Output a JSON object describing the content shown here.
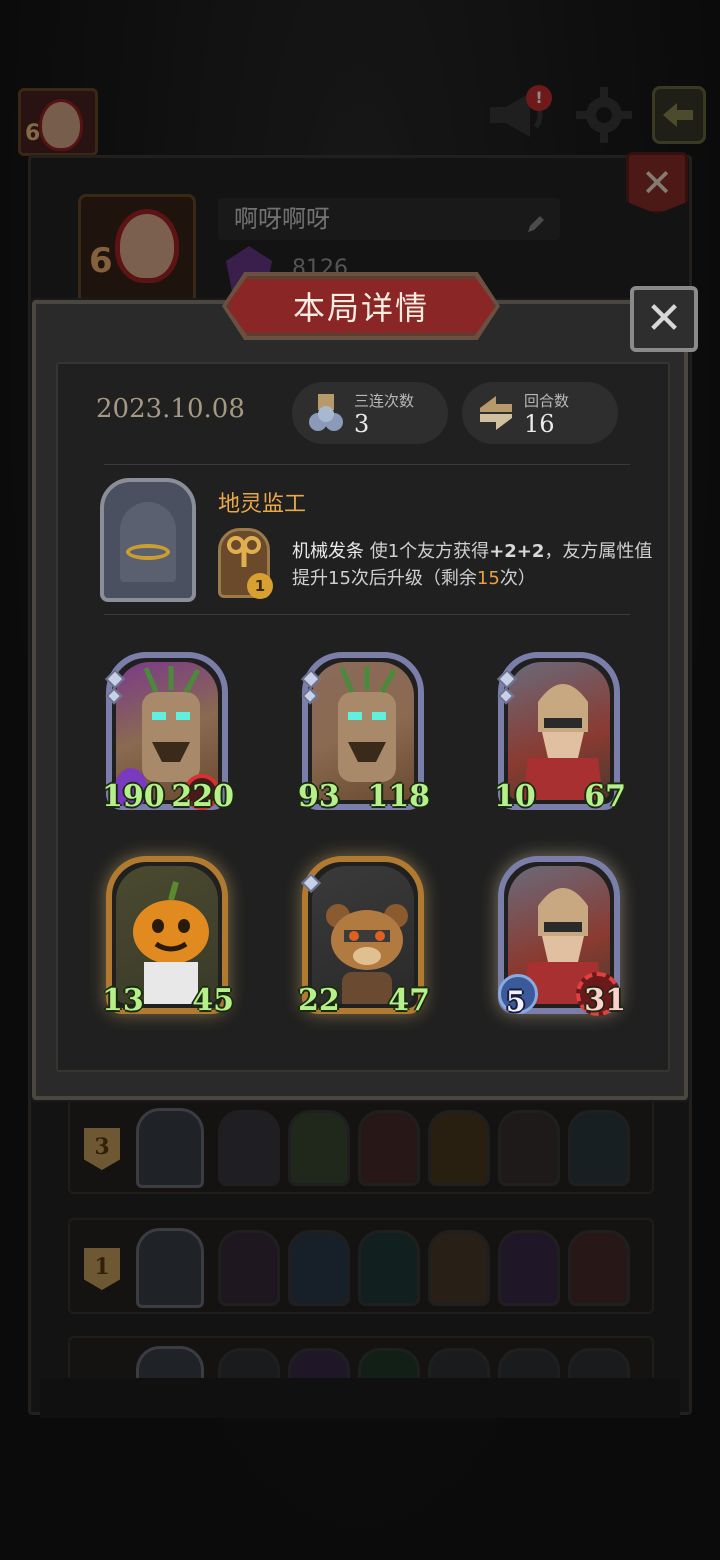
{
  "background": {
    "player_name": "啊呀啊呀",
    "score": "8126",
    "avatar_level": "6",
    "notification_badge": "!",
    "icons": [
      "megaphone-icon",
      "gear-icon",
      "exit-icon",
      "close-icon",
      "edit-icon"
    ]
  },
  "modal": {
    "title": "本局详情",
    "close_label": "✕",
    "date": "2023.10.08",
    "stats": [
      {
        "label": "三连次数",
        "value": "3",
        "icon": "triple-icon"
      },
      {
        "label": "回合数",
        "value": "16",
        "icon": "round-icon"
      }
    ],
    "hero": {
      "name": "地灵监工",
      "skill_name": "机械发条",
      "skill_desc_1": " 使1个友方获得",
      "skill_bonus": "+2+2",
      "skill_desc_2": "，友方属性值提升15次后升级（剩余",
      "skill_remaining": "15",
      "skill_desc_3": "次）",
      "skill_level": "1"
    },
    "cards": [
      {
        "name": "treant-card",
        "attack": "190",
        "health": "220",
        "frame": "silver"
      },
      {
        "name": "treant-card",
        "attack": "93",
        "health": "118",
        "frame": "silver"
      },
      {
        "name": "knight-card",
        "attack": "10",
        "health": "67",
        "frame": "silver"
      },
      {
        "name": "pumpkin-card",
        "attack": "13",
        "health": "45",
        "frame": "gold"
      },
      {
        "name": "bear-card",
        "attack": "22",
        "health": "47",
        "frame": "gold"
      },
      {
        "name": "knight-card",
        "attack": "5",
        "health": "31",
        "frame": "silver"
      }
    ]
  },
  "history": [
    {
      "rank": "3"
    },
    {
      "rank": "1"
    },
    {
      "rank": ""
    }
  ],
  "colors": {
    "accent_title": "#8a2626",
    "hero_name": "#e9a84a",
    "stat_green": "#b6f08a",
    "highlight_orange": "#e8a040"
  }
}
